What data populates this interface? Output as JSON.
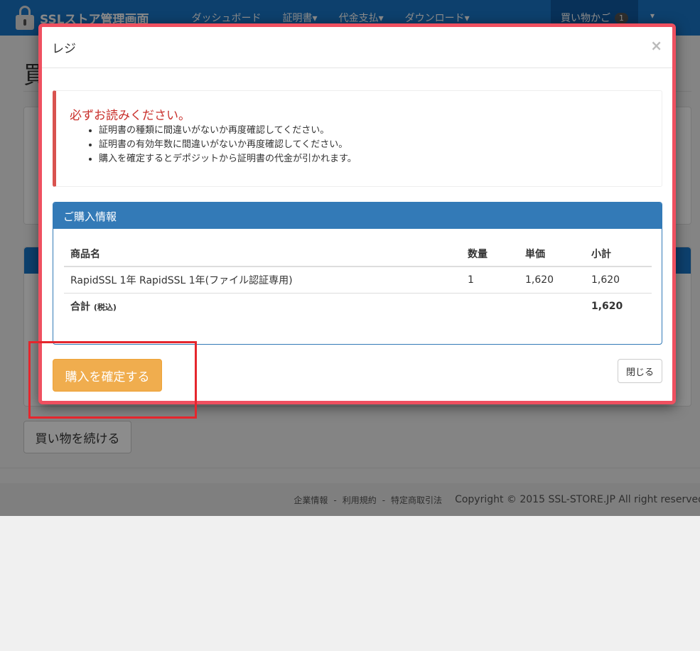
{
  "navbar": {
    "brand": "SSLストア管理画面",
    "items": [
      "ダッシュボード",
      "証明書▾",
      "代金支払▾",
      "ダウンロード▾"
    ],
    "cart_label": "買い物かご",
    "cart_count": "1",
    "user_caret": "▾"
  },
  "page": {
    "heading": "買",
    "continue_label": "買い物を続ける"
  },
  "footer": {
    "links": [
      "企業情報",
      "利用規約",
      "特定商取引法"
    ],
    "separator": "-",
    "copyright": "Copyright © 2015 SSL-STORE.JP All right reserved"
  },
  "modal": {
    "title": "レジ",
    "close_icon": "×",
    "alert": {
      "title": "必ずお読みください。",
      "items": [
        "証明書の種類に間違いがないか再度確認してください。",
        "証明書の有効年数に間違いがないか再度確認してください。",
        "購入を確定するとデポジットから証明書の代金が引かれます。"
      ]
    },
    "panel": {
      "heading": "ご購入情報",
      "columns": [
        "商品名",
        "数量",
        "単価",
        "小計"
      ],
      "rows": [
        [
          "RapidSSL 1年 RapidSSL 1年(ファイル認証専用)",
          "1",
          "1,620",
          "1,620"
        ]
      ],
      "total_label": "合計",
      "total_note": "(税込)",
      "total_value": "1,620"
    },
    "confirm_label": "購入を確定する",
    "close_label": "閉じる"
  },
  "colors": {
    "navbar": "#1976c7",
    "modal_border": "#ef5060",
    "panel_primary": "#337ab7",
    "warning_button": "#f0ad4e",
    "alert_accent": "#d9534f",
    "annotation": "#e5262d"
  }
}
